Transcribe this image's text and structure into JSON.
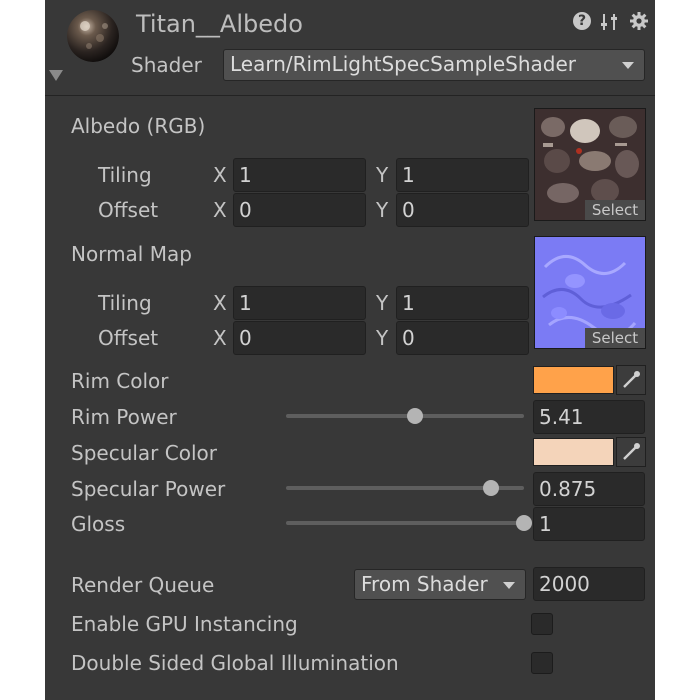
{
  "header": {
    "material_name": "Titan__Albedo",
    "shader_label": "Shader",
    "shader_value": "Learn/RimLightSpecSampleShader",
    "icons": [
      "help-icon",
      "preset-icon",
      "gear-icon"
    ]
  },
  "albedo": {
    "label": "Albedo (RGB)",
    "tiling_label": "Tiling",
    "offset_label": "Offset",
    "x_label": "X",
    "y_label": "Y",
    "tiling_x": "1",
    "tiling_y": "1",
    "offset_x": "0",
    "offset_y": "0",
    "select_label": "Select"
  },
  "normal": {
    "label": "Normal Map",
    "tiling_label": "Tiling",
    "offset_label": "Offset",
    "x_label": "X",
    "y_label": "Y",
    "tiling_x": "1",
    "tiling_y": "1",
    "offset_x": "0",
    "offset_y": "0",
    "select_label": "Select"
  },
  "rim_color": {
    "label": "Rim Color",
    "color": "#FFA24A"
  },
  "rim_power": {
    "label": "Rim Power",
    "value": "5.41",
    "slider_fraction": 0.54
  },
  "specular_color": {
    "label": "Specular Color",
    "color": "#F4D4BA"
  },
  "specular_power": {
    "label": "Specular Power",
    "value": "0.875",
    "slider_fraction": 0.86
  },
  "gloss": {
    "label": "Gloss",
    "value": "1",
    "slider_fraction": 1.0
  },
  "render_queue": {
    "label": "Render Queue",
    "mode": "From Shader",
    "value": "2000"
  },
  "gpu_instancing": {
    "label": "Enable GPU Instancing",
    "checked": false
  },
  "double_sided_gi": {
    "label": "Double Sided Global Illumination",
    "checked": false
  },
  "colors": {
    "panel_bg": "#383838",
    "field_bg": "#2A2A2A",
    "text": "#C4C4C4",
    "normal_map_tint": "#7B7BFF"
  }
}
